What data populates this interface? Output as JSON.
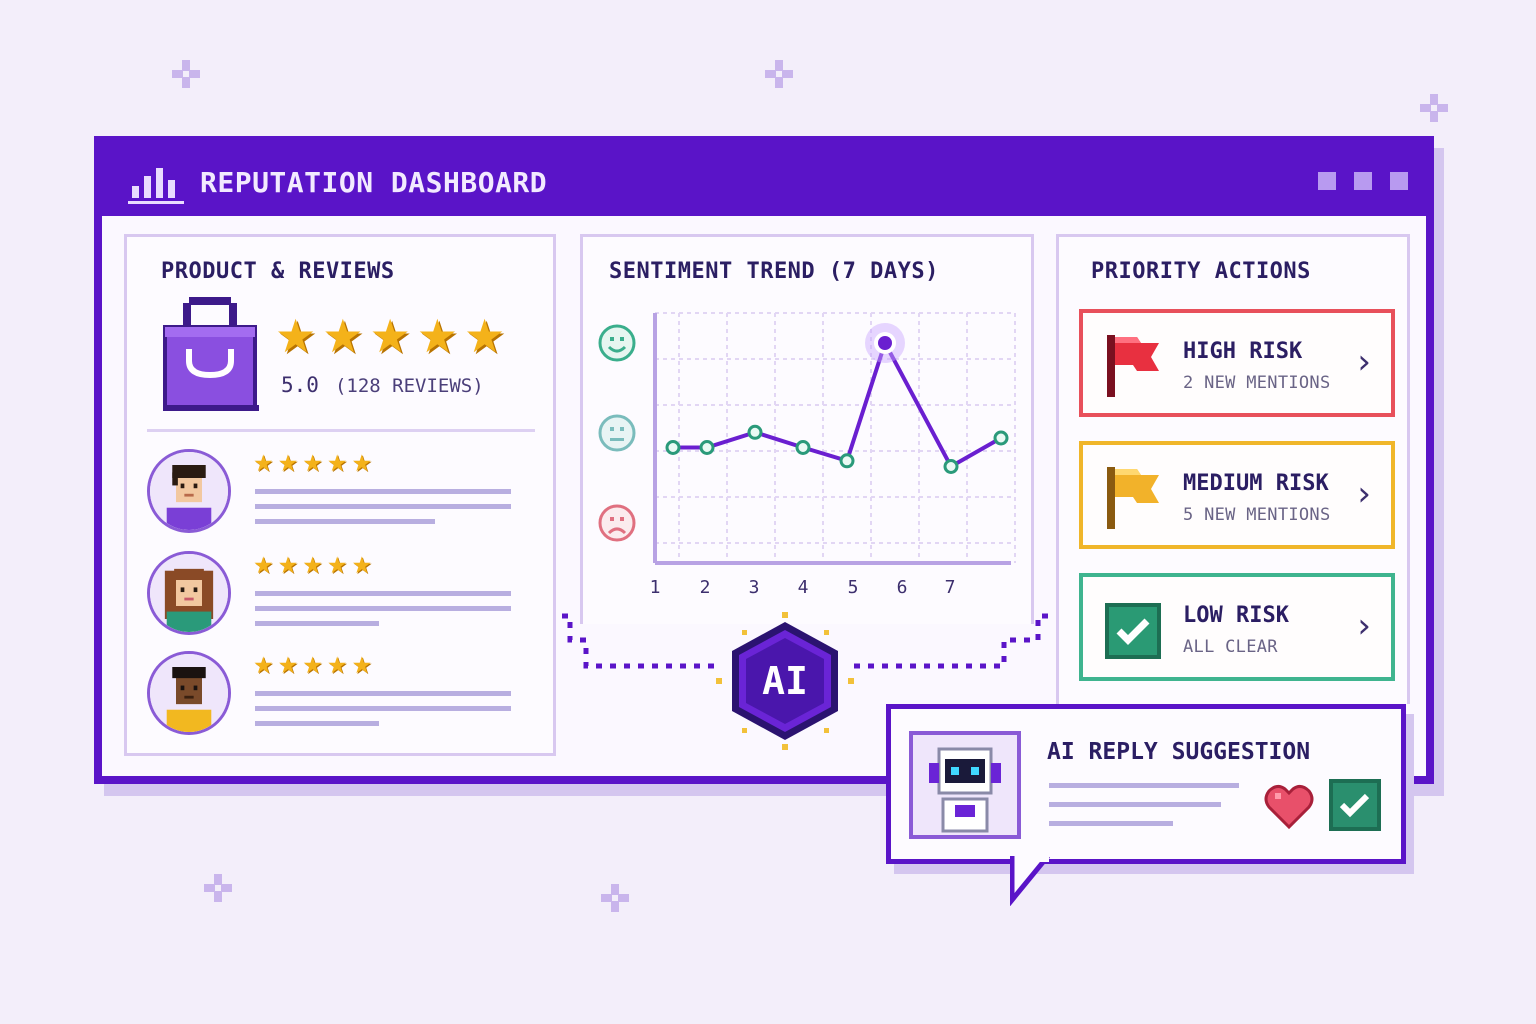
{
  "window": {
    "title": "REPUTATION DASHBOARD",
    "accent_color": "#5a14c8"
  },
  "product_panel": {
    "title": "PRODUCT & REVIEWS",
    "product_icon": "shopping-bag-icon",
    "rating": "5.0",
    "review_count": "(128 REVIEWS)",
    "stars": 5,
    "reviews": [
      {
        "avatar": "avatar-man-icon",
        "stars": 5
      },
      {
        "avatar": "avatar-woman-icon",
        "stars": 5
      },
      {
        "avatar": "avatar-man-icon",
        "stars": 5
      }
    ]
  },
  "sentiment_panel": {
    "title": "SENTIMENT TREND (7 DAYS)",
    "faces": [
      "happy-face-icon",
      "neutral-face-icon",
      "sad-face-icon"
    ]
  },
  "chart_data": {
    "type": "line",
    "categories": [
      "1",
      "2",
      "3",
      "4",
      "5",
      "6",
      "7"
    ],
    "x_tick_labels": [
      "1",
      "2",
      "3",
      "4",
      "5",
      "6",
      "7"
    ],
    "series": [
      {
        "values": [
          0.45,
          0.45,
          0.53,
          0.45,
          0.38,
          1.0,
          0.35,
          0.5
        ]
      }
    ],
    "highlight_peak_index": 5,
    "grid": true,
    "line_color": "#6a1fd0",
    "marker_color": "#2a9a7a"
  },
  "ai_badge": {
    "label": "AI"
  },
  "priority_panel": {
    "title": "PRIORITY ACTIONS",
    "actions": [
      {
        "title": "HIGH RISK",
        "subtitle": "2 NEW MENTIONS",
        "icon": "red-flag-icon",
        "color": "#e8505b"
      },
      {
        "title": "MEDIUM RISK",
        "subtitle": "5 NEW MENTIONS",
        "icon": "yellow-flag-icon",
        "color": "#f0b62a"
      },
      {
        "title": "LOW RISK",
        "subtitle": "ALL CLEAR",
        "icon": "checkmark-icon",
        "color": "#3fb48f"
      }
    ]
  },
  "ai_reply": {
    "title": "AI REPLY SUGGESTION",
    "robot_icon": "robot-icon",
    "like_icon": "heart-icon",
    "approve_icon": "checkmark-icon"
  }
}
